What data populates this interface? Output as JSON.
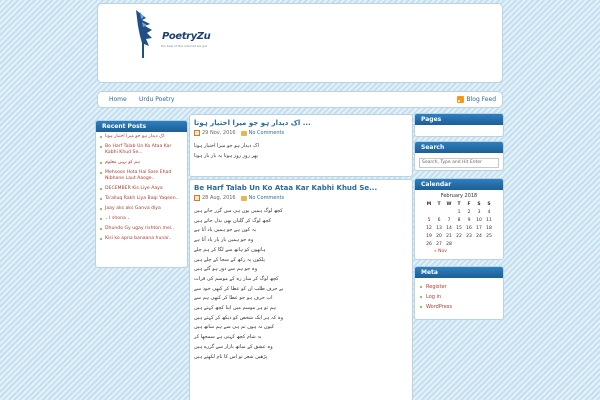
{
  "header": {
    "site_name": "PoetryZu",
    "tagline": "the best of the internet we got"
  },
  "nav": {
    "home": "Home",
    "urdu": "Urdu Poetry",
    "feed": "Blog Feed"
  },
  "recent": {
    "title": "Recent Posts",
    "items": [
      "اک دیدار ہو جو میرا اختیار ہوتا",
      "Be Harf Talab Un Ko Ataa Kar Kabhi Khud Se...",
      "ہم کو نہیں معلوم",
      "Mehsoos Hota Hai Sare Ehad Nibhane Laut Aaoge..",
      "DECEMBER Kis Liye Aaya",
      "Ta'alluq Rakh Liya Baqi Yaqeen..",
      "Jaay aks aks Ganva diya",
      "۔ I shona ۔",
      "Dhundo Gy ugay rishton mei..",
      "Kisi ko apna banaana hunar.."
    ]
  },
  "posts": [
    {
      "title": "اک دیدار ہو جو میرا اختیار ہوتا ...",
      "date": "29 Nov, 2016",
      "comments": "No Comments",
      "lines": [
        "اک دیدار ہو جو میرا اختیار ہوتا",
        "پھر روز روز ہوتا یہ بار بار ہوتا"
      ]
    },
    {
      "title": "Be Harf Talab Un Ko Ataa Kar Kabhi Khud Se...",
      "date": "28 Aug, 2016",
      "comments": "No Comments",
      "lines": [
        "کچھ لوگ ہمیں یوں ہی میں گزر جاتے ہیں",
        "کچھ لوگ کر گلیاں بھی بدل جاتے ہیں",
        "یہ کون ہے جو ہمیں یاد آتا ہے",
        "وہ جو ہمیں بار بار یاد آتا ہے",
        "ہاتھوں کو ہاتھ سے لگا کر ہم چلے",
        "پلکوں پہ رکھ کے سجا کے چلے ہیں",
        "وہ جو ہم سے دور ہو گئے ہیں",
        "کچھ لوگ کر ساز رہ کے موسم کی قرات",
        "بے حرف طلب ان کو عطا کر کبھی خود سے",
        "اب حرف ہو جو عطا کر کبھی ہم سے",
        "ہم تو ہر موسم میں اپنا کچھ کہتے ہیں",
        "وہ کہ ہر ایک شخص کو دیکھ کر کہتے ہیں",
        "کیوں نہ ہوں تم ہی سے ہم ساتھ ہیں",
        "یہ شام کچھ کہتی ہے سمجھا کر",
        "وہ عشق کے ساتھ بازار سے گزرے ہیں",
        "پڑھیں شعر تو اس کا نام لکھتے ہیں"
      ]
    }
  ],
  "sidebar": {
    "pages_title": "Pages",
    "search_title": "Search",
    "search_placeholder": "Search, Type and Hit Enter",
    "calendar_title": "Calendar",
    "calendar_caption": "February 2018",
    "calendar_days": [
      "M",
      "T",
      "W",
      "T",
      "F",
      "S",
      "S"
    ],
    "calendar_weeks": [
      [
        "",
        "",
        "",
        "1",
        "2",
        "3",
        "4"
      ],
      [
        "5",
        "6",
        "7",
        "8",
        "9",
        "10",
        "11"
      ],
      [
        "12",
        "13",
        "14",
        "15",
        "16",
        "17",
        "18"
      ],
      [
        "19",
        "20",
        "21",
        "22",
        "23",
        "24",
        "25"
      ],
      [
        "26",
        "27",
        "28",
        "",
        "",
        "",
        ""
      ]
    ],
    "calendar_prev": "« Nov",
    "meta_title": "Meta",
    "meta_items": [
      "Register",
      "Log in",
      "WordPress"
    ]
  },
  "colors": {
    "title_bar": "#1c5f97",
    "link": "#2b6a9b",
    "recent_link": "#b03a2e",
    "bullet": "#7ab02c",
    "background": "#cfe6f3"
  }
}
